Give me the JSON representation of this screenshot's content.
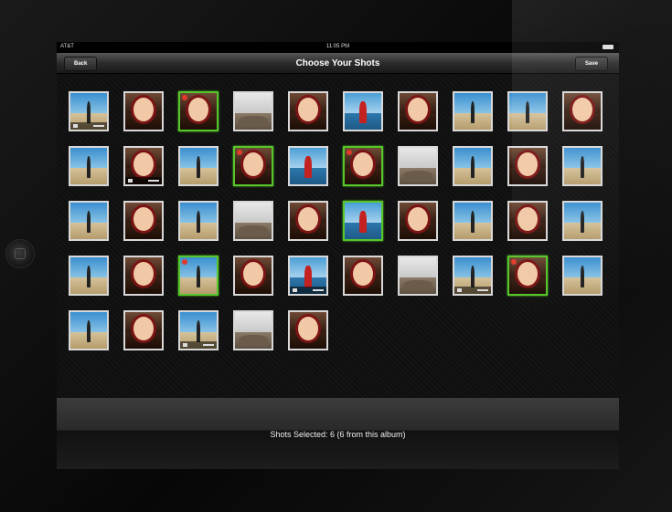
{
  "statusbar": {
    "carrier": "AT&T",
    "time": "11:05 PM"
  },
  "navbar": {
    "back_label": "Back",
    "title": "Choose Your Shots",
    "save_label": "Save"
  },
  "footer": {
    "selected_text": "Shots Selected: 6 (6 from this album)"
  },
  "thumbnails": [
    {
      "kind": "beach",
      "selected": false,
      "badge": false,
      "video": true
    },
    {
      "kind": "portrait",
      "selected": false,
      "badge": false,
      "video": false
    },
    {
      "kind": "portrait",
      "selected": true,
      "badge": true,
      "video": false
    },
    {
      "kind": "rocks",
      "selected": false,
      "badge": false,
      "video": false
    },
    {
      "kind": "portrait",
      "selected": false,
      "badge": false,
      "video": false
    },
    {
      "kind": "sea",
      "selected": false,
      "badge": false,
      "video": false
    },
    {
      "kind": "portrait",
      "selected": false,
      "badge": false,
      "video": false
    },
    {
      "kind": "beach",
      "selected": false,
      "badge": false,
      "video": false
    },
    {
      "kind": "beach",
      "selected": false,
      "badge": false,
      "video": false
    },
    {
      "kind": "portrait",
      "selected": false,
      "badge": false,
      "video": false
    },
    {
      "kind": "beach",
      "selected": false,
      "badge": false,
      "video": false
    },
    {
      "kind": "portrait",
      "selected": false,
      "badge": false,
      "video": true
    },
    {
      "kind": "beach",
      "selected": false,
      "badge": false,
      "video": false
    },
    {
      "kind": "portrait",
      "selected": true,
      "badge": true,
      "video": false
    },
    {
      "kind": "sea",
      "selected": false,
      "badge": false,
      "video": false
    },
    {
      "kind": "portrait",
      "selected": true,
      "badge": true,
      "video": false
    },
    {
      "kind": "rocks",
      "selected": false,
      "badge": false,
      "video": false
    },
    {
      "kind": "beach",
      "selected": false,
      "badge": false,
      "video": false
    },
    {
      "kind": "portrait",
      "selected": false,
      "badge": false,
      "video": false
    },
    {
      "kind": "beach",
      "selected": false,
      "badge": false,
      "video": false
    },
    {
      "kind": "beach",
      "selected": false,
      "badge": false,
      "video": false
    },
    {
      "kind": "portrait",
      "selected": false,
      "badge": false,
      "video": false
    },
    {
      "kind": "beach",
      "selected": false,
      "badge": false,
      "video": false
    },
    {
      "kind": "rocks",
      "selected": false,
      "badge": false,
      "video": false
    },
    {
      "kind": "portrait",
      "selected": false,
      "badge": false,
      "video": false
    },
    {
      "kind": "sea",
      "selected": true,
      "badge": false,
      "video": false
    },
    {
      "kind": "portrait",
      "selected": false,
      "badge": false,
      "video": false
    },
    {
      "kind": "beach",
      "selected": false,
      "badge": false,
      "video": false
    },
    {
      "kind": "portrait",
      "selected": false,
      "badge": false,
      "video": false
    },
    {
      "kind": "beach",
      "selected": false,
      "badge": false,
      "video": false
    },
    {
      "kind": "beach",
      "selected": false,
      "badge": false,
      "video": false
    },
    {
      "kind": "portrait",
      "selected": false,
      "badge": false,
      "video": false
    },
    {
      "kind": "beach",
      "selected": true,
      "badge": true,
      "video": false
    },
    {
      "kind": "portrait",
      "selected": false,
      "badge": false,
      "video": false
    },
    {
      "kind": "sea",
      "selected": false,
      "badge": false,
      "video": true
    },
    {
      "kind": "portrait",
      "selected": false,
      "badge": false,
      "video": false
    },
    {
      "kind": "rocks",
      "selected": false,
      "badge": false,
      "video": false
    },
    {
      "kind": "beach",
      "selected": false,
      "badge": false,
      "video": true
    },
    {
      "kind": "portrait",
      "selected": true,
      "badge": true,
      "video": false
    },
    {
      "kind": "beach",
      "selected": false,
      "badge": false,
      "video": false
    },
    {
      "kind": "beach",
      "selected": false,
      "badge": false,
      "video": false
    },
    {
      "kind": "portrait",
      "selected": false,
      "badge": false,
      "video": false
    },
    {
      "kind": "beach",
      "selected": false,
      "badge": false,
      "video": true
    },
    {
      "kind": "rocks",
      "selected": false,
      "badge": false,
      "video": false
    },
    {
      "kind": "portrait",
      "selected": false,
      "badge": false,
      "video": false
    }
  ]
}
